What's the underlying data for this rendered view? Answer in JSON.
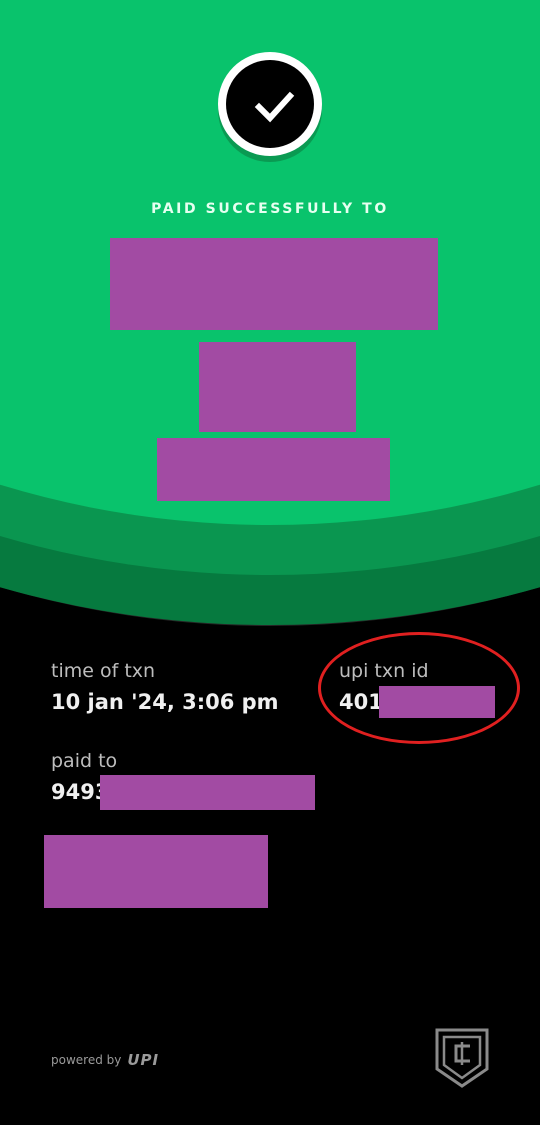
{
  "header": {
    "status_text": "PAID SUCCESSFULLY TO",
    "icon": "check-icon"
  },
  "details": {
    "time_label": "time of txn",
    "time_value": "10 jan '24, 3:06 pm",
    "txn_id_label": "upi txn id",
    "txn_id_value": "401",
    "paid_to_label": "paid to",
    "paid_to_value": "9493"
  },
  "footer": {
    "powered_by": "powered by",
    "upi_logo_text": "UPI"
  },
  "colors": {
    "success_green": "#09c36c",
    "redaction": "#a24ba3",
    "highlight": "#e02020",
    "background": "#000000"
  }
}
